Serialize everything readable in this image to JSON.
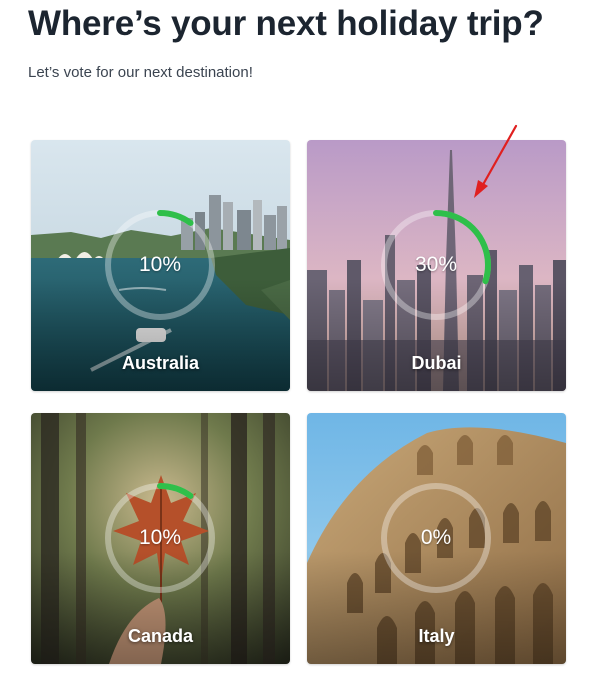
{
  "page": {
    "title": "Where’s your next holiday trip?",
    "subtitle": "Let’s vote for our next destination!"
  },
  "colors": {
    "accent_green": "#2fbf4a",
    "ring_track": "rgba(255,255,255,0.35)",
    "annotation_red": "#e02020"
  },
  "destinations": [
    {
      "name": "Australia",
      "percent_label": "10%",
      "percent": 10
    },
    {
      "name": "Dubai",
      "percent_label": "30%",
      "percent": 30
    },
    {
      "name": "Canada",
      "percent_label": "10%",
      "percent": 10
    },
    {
      "name": "Italy",
      "percent_label": "0%",
      "percent": 0
    }
  ],
  "annotation": {
    "icon": "red-arrow-pointer"
  }
}
